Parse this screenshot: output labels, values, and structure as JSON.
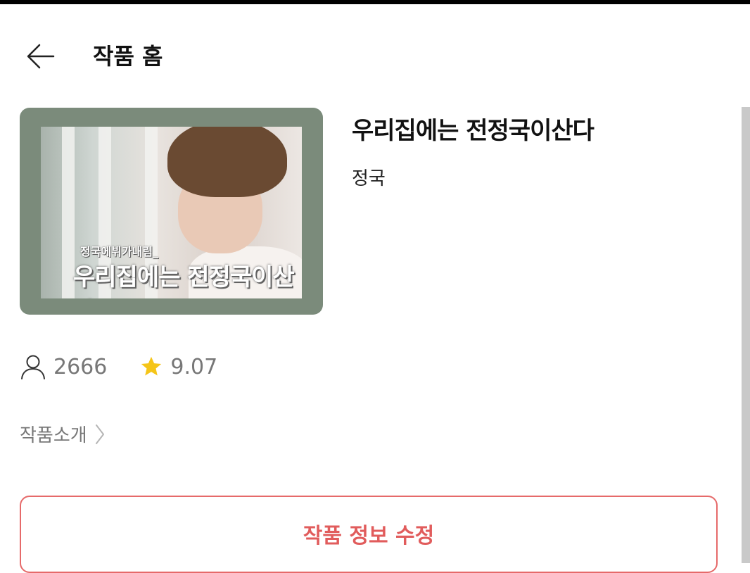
{
  "header": {
    "back_icon": "arrow-left-icon",
    "title": "작품 홈"
  },
  "work": {
    "cover": {
      "subtitle": "정국에뷔가내림_",
      "title": "우리집에는 전정국이산다",
      "frame_color": "#7b8b7b"
    },
    "title": "우리집에는 전정국이산다",
    "author": "정국"
  },
  "stats": {
    "views_icon": "user-icon",
    "views": "2666",
    "rating_icon": "star-icon",
    "rating": "9.07",
    "star_color": "#f5c518"
  },
  "intro": {
    "label": "작품소개",
    "icon": "chevron-right-icon"
  },
  "actions": {
    "edit_label": "작품 정보 수정",
    "accent_color": "#e15c5c"
  }
}
